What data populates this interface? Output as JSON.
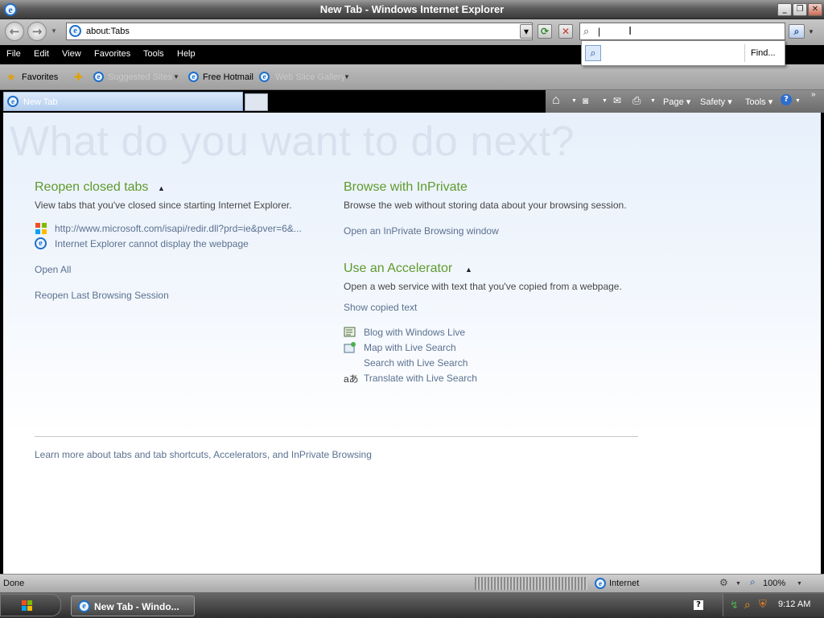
{
  "window": {
    "title": "New Tab - Windows Internet Explorer"
  },
  "address": {
    "url": "about:Tabs"
  },
  "search": {
    "value": "|",
    "find_label": "Find..."
  },
  "menu": [
    "File",
    "Edit",
    "View",
    "Favorites",
    "Tools",
    "Help"
  ],
  "favorites": {
    "label": "Favorites",
    "item": "Free Hotmail"
  },
  "tab": {
    "label": "New Tab"
  },
  "commands": {
    "page": "Page",
    "safety": "Safety",
    "tools": "Tools"
  },
  "page": {
    "headline": "What do you want to do next?",
    "reopen": {
      "heading": "Reopen closed tabs",
      "desc": "View tabs that you've closed since starting Internet Explorer.",
      "items": [
        {
          "icon": "windows-flag-icon",
          "label": "http://www.microsoft.com/isapi/redir.dll?prd=ie&pver=6&..."
        },
        {
          "icon": "ie-icon",
          "label": "Internet Explorer cannot display the webpage"
        }
      ],
      "open_all": "Open All",
      "reopen_session": "Reopen Last Browsing Session"
    },
    "inprivate": {
      "heading": "Browse with InPrivate",
      "desc": "Browse the web without storing data about your browsing session.",
      "link": "Open an InPrivate Browsing window"
    },
    "accelerator": {
      "heading": "Use an Accelerator",
      "desc": "Open a web service with text that you've copied from a webpage.",
      "show_copied": "Show copied text",
      "items": [
        {
          "icon": "blog-icon",
          "label": "Blog with Windows Live"
        },
        {
          "icon": "map-icon",
          "label": "Map with Live Search"
        },
        {
          "icon": "",
          "label": "Search with Live Search"
        },
        {
          "icon": "translate-icon",
          "label": "Translate with Live Search"
        }
      ]
    },
    "learn_more": "Learn more about tabs and tab shortcuts, Accelerators, and InPrivate Browsing"
  },
  "status": {
    "text": "Done",
    "zone": "Internet",
    "zoom": "100%"
  },
  "taskbar": {
    "button": "New Tab - Windo...",
    "clock": "9:12 AM"
  },
  "colors": {
    "heading_green": "#5f9a2c",
    "link_blue": "#5b7190",
    "headline_ghost": "#d8e1ee"
  }
}
